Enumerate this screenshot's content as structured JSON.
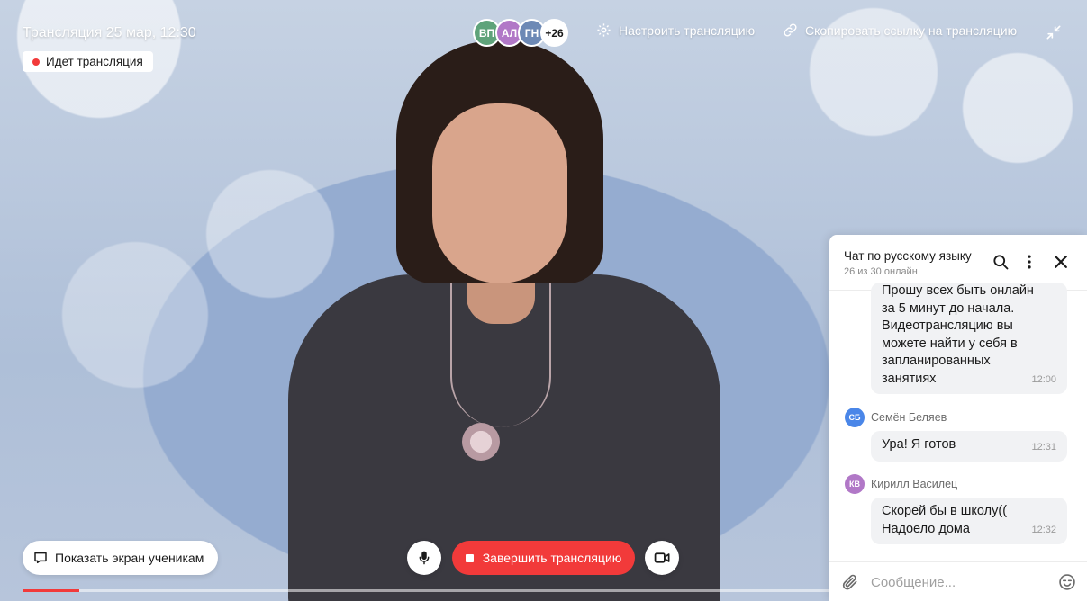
{
  "stream": {
    "title": "Трансляция 25 мар, 12:30",
    "status_label": "Идет трансляция",
    "participants": [
      {
        "initials": "ВП",
        "color": "#5fa37a"
      },
      {
        "initials": "АЛ",
        "color": "#b178c7"
      },
      {
        "initials": "ГН",
        "color": "#6d89b5"
      }
    ],
    "participants_more": "+26",
    "settings_label": "Настроить трансляцию",
    "copy_link_label": "Скопировать ссылку на трансляцию",
    "progress": 0.07
  },
  "controls": {
    "share_screen_label": "Показать экран ученикам",
    "end_stream_label": "Завершить трансляцию"
  },
  "chat": {
    "title": "Чат по русскому языку",
    "subtitle": "26 из 30 онлайн",
    "messages": [
      {
        "lines": [
          "Прошу всех быть онлайн",
          "за 5 минут до начала.",
          "Видеотрансляцию вы",
          "можете найти у себя в",
          "запланированных",
          "занятиях"
        ],
        "time": "12:00"
      },
      {
        "sender": "Семён Беляев",
        "initials": "СБ",
        "avatar_color": "#4a86e8",
        "lines": [
          "Ура! Я готов"
        ],
        "time": "12:31"
      },
      {
        "sender": "Кирилл Василец",
        "initials": "КВ",
        "avatar_color": "#b178c7",
        "lines": [
          "Скорей бы в школу((",
          "Надоело дома"
        ],
        "time": "12:32"
      }
    ],
    "input_placeholder": "Сообщение..."
  },
  "colors": {
    "accent_red": "#f23a3a",
    "bubble_bg": "#f1f2f4"
  }
}
